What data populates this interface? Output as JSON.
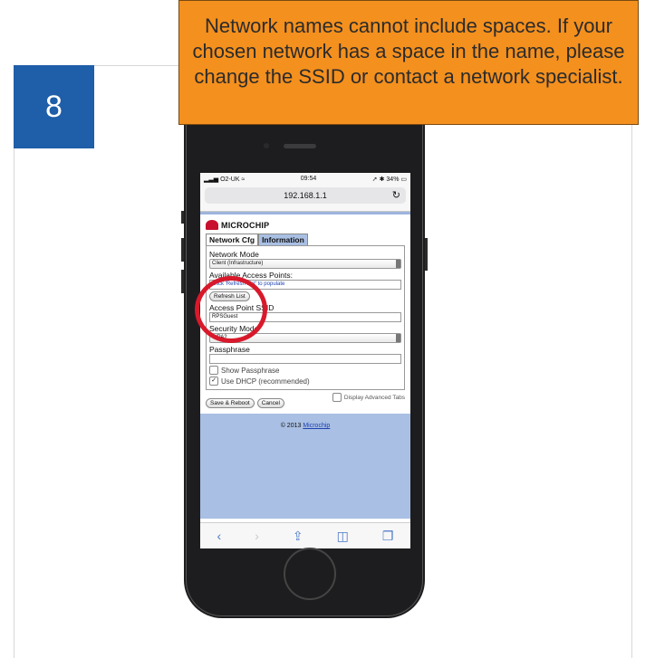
{
  "step": {
    "number": "8"
  },
  "callout": {
    "text": "Network names cannot include spaces. If your chosen network has a space in the name, please change the SSID or contact a network specialist."
  },
  "colors": {
    "accent_blue": "#1f5ea8",
    "callout_orange": "#f4901e",
    "highlight_red": "#d8192b"
  },
  "phone": {
    "status": {
      "carrier": "O2-UK",
      "time": "09:54",
      "battery": "34%"
    },
    "address_bar": {
      "url": "192.168.1.1",
      "reload_icon": "reload-icon"
    },
    "page": {
      "brand": "MICROCHIP",
      "tabs": [
        {
          "label": "Network Cfg"
        },
        {
          "label": "Information"
        }
      ],
      "network_mode": {
        "label": "Network Mode",
        "value": "Client (Infrastructure)"
      },
      "access_points": {
        "label": "Available Access Points:",
        "value": "Click 'Refresh List' to populate",
        "refresh_label": "Refresh List"
      },
      "ssid": {
        "label": "Access Point SSID",
        "value": "RPSGuest"
      },
      "security": {
        "label": "Security Mode",
        "value": "WPA2"
      },
      "passphrase": {
        "label": "Passphrase",
        "value": ""
      },
      "show_passphrase": {
        "label": "Show Passphrase",
        "checked": false
      },
      "use_dhcp": {
        "label": "Use DHCP (recommended)",
        "checked": true
      },
      "save_label": "Save & Reboot",
      "cancel_label": "Cancel",
      "advanced_label": "Display Advanced Tabs",
      "footer": {
        "copyright": "© 2013",
        "link": "Microchip"
      }
    },
    "toolbar": {
      "back_icon": "back-icon",
      "forward_icon": "forward-icon",
      "share_icon": "share-icon",
      "bookmarks_icon": "bookmarks-icon",
      "tabs_icon": "tabs-icon",
      "back_glyph": "‹",
      "forward_glyph": "›",
      "share_glyph": "⇪",
      "bookmarks_glyph": "📖",
      "tabs_glyph": "❐"
    }
  }
}
